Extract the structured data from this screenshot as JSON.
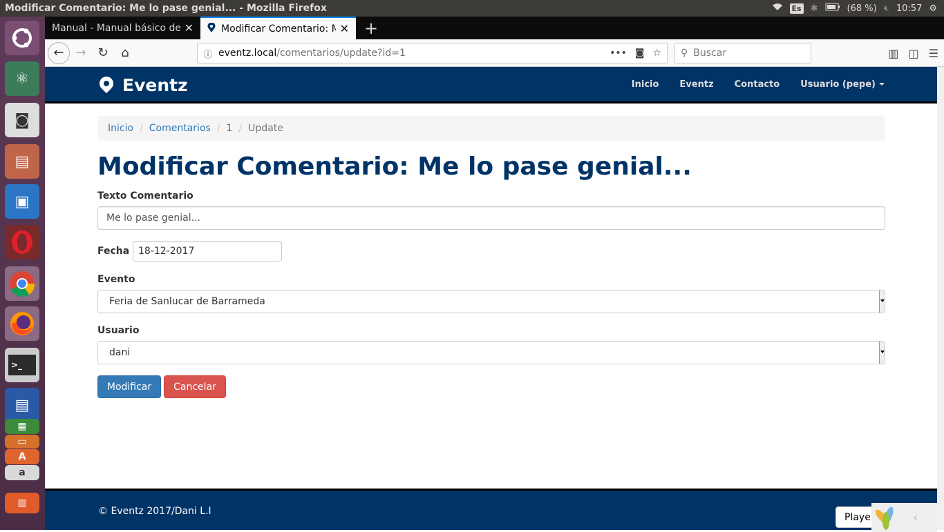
{
  "system": {
    "window_title": "Modificar Comentario: Me lo pase genial... - Mozilla Firefox",
    "keyboard": "Es",
    "battery": "(68 %)",
    "clock": "10:57"
  },
  "launcher": {
    "items": [
      "ubuntu-dash",
      "atom",
      "camera",
      "files",
      "brackets",
      "opera",
      "chrome",
      "firefox",
      "terminal",
      "writer",
      "calc",
      "impress",
      "software",
      "store",
      "trash"
    ]
  },
  "browser": {
    "tabs": [
      {
        "label": "Manual - Manual básico de C",
        "active": false
      },
      {
        "label": "Modificar Comentario: M",
        "active": true
      }
    ],
    "url_host": "eventz.local",
    "url_path": "/comentarios/update?id=1",
    "search_placeholder": "Buscar"
  },
  "site": {
    "brand": "Eventz",
    "nav": {
      "inicio": "Inicio",
      "eventz": "Eventz",
      "contacto": "Contacto",
      "usuario": "Usuario (pepe)"
    },
    "breadcrumb": {
      "inicio": "Inicio",
      "comentarios": "Comentarios",
      "id": "1",
      "current": "Update"
    },
    "title": "Modificar Comentario: Me lo pase genial...",
    "form": {
      "texto_label": "Texto Comentario",
      "texto_value": "Me lo pase genial...",
      "fecha_label": "Fecha",
      "fecha_value": "18-12-2017",
      "evento_label": "Evento",
      "evento_value": "Feria de Sanlucar de Barrameda",
      "usuario_label": "Usuario",
      "usuario_value": "dani",
      "submit": "Modificar",
      "cancel": "Cancelar"
    },
    "footer": {
      "copyright": "© Eventz 2017/Dani L.I",
      "player": "Playe"
    }
  },
  "colors": {
    "navy": "#003366",
    "primary": "#337ab7",
    "danger": "#d9534f"
  }
}
